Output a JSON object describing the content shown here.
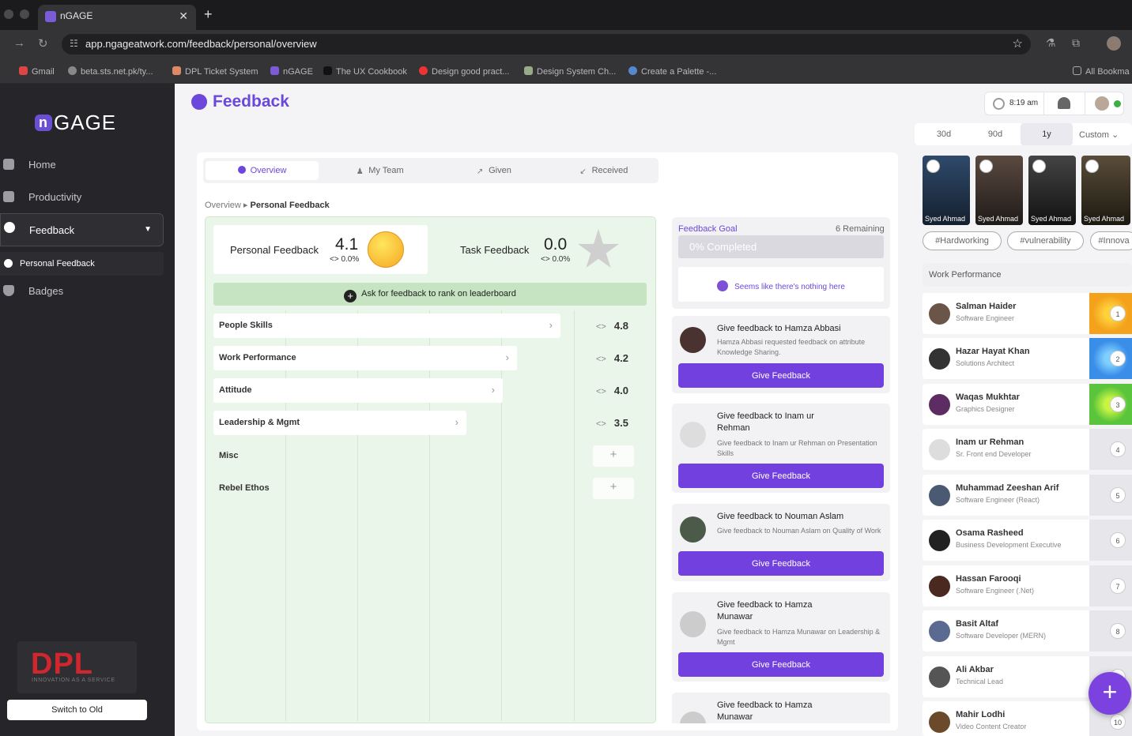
{
  "browser": {
    "tab_title": "nGAGE",
    "url": "app.ngageatwork.com/feedback/personal/overview",
    "bookmarks": [
      "Gmail",
      "beta.sts.net.pk/ty...",
      "DPL Ticket System",
      "nGAGE",
      "The UX Cookbook",
      "Design good pract...",
      "Design System Ch...",
      "Create a Palette -..."
    ],
    "all_bookmarks": "All Bookma"
  },
  "sidebar": {
    "logo": "GAGE",
    "logo_prefix": "n",
    "items": [
      {
        "label": "Home"
      },
      {
        "label": "Productivity"
      },
      {
        "label": "Feedback"
      },
      {
        "label": "Personal Feedback"
      },
      {
        "label": "Badges"
      }
    ],
    "dpl": {
      "title": "DPL",
      "tagline": "INNOVATION AS A SERVICE"
    },
    "switch_label": "Switch to Old"
  },
  "header": {
    "title": "Feedback",
    "time": "8:19 am"
  },
  "periods": [
    "30d",
    "90d",
    "1y",
    "Custom"
  ],
  "tabs": [
    "Overview",
    "My Team",
    "Given",
    "Received"
  ],
  "breadcrumb": {
    "parent": "Overview",
    "current": "Personal Feedback"
  },
  "scores": {
    "personal": {
      "label": "Personal Feedback",
      "value": "4.1",
      "change": "<> 0.0%"
    },
    "task": {
      "label": "Task Feedback",
      "value": "0.0",
      "change": "<> 0.0%"
    },
    "ask": "Ask for feedback to rank on leaderboard"
  },
  "attributes": [
    {
      "name": "People Skills",
      "score": "4.8"
    },
    {
      "name": "Work Performance",
      "score": "4.2"
    },
    {
      "name": "Attitude",
      "score": "4.0"
    },
    {
      "name": "Leadership & Mgmt",
      "score": "3.5"
    },
    {
      "name": "Misc",
      "score": ""
    },
    {
      "name": "Rebel Ethos",
      "score": ""
    }
  ],
  "goal": {
    "label": "Feedback Goal",
    "remaining": "6 Remaining",
    "progress": "0% Completed",
    "progress_value": 0,
    "empty": "Seems like there's nothing here"
  },
  "requests": [
    {
      "title": "Give feedback to Hamza Abbasi",
      "desc": "Hamza Abbasi requested feedback on attribute Knowledge Sharing.",
      "button": "Give Feedback"
    },
    {
      "title": "Give feedback to Inam ur Rehman",
      "desc": "Give feedback to Inam ur Rehman on Presentation Skills",
      "button": "Give Feedback"
    },
    {
      "title": "Give feedback to Nouman Aslam",
      "desc": "Give feedback to Nouman Aslam on Quality of Work",
      "button": "Give Feedback"
    },
    {
      "title": "Give feedback to Hamza Munawar",
      "desc": "Give feedback to Hamza Munawar on Leadership & Mgmt",
      "button": "Give Feedback"
    },
    {
      "title": "Give feedback to Hamza Munawar",
      "desc": "",
      "button": ""
    }
  ],
  "videos": [
    "Syed Ahmad",
    "Syed Ahmad",
    "Syed Ahmad",
    "Syed Ahmad"
  ],
  "tags": [
    "#Hardworking",
    "#vulnerability",
    "#Innova"
  ],
  "leaderboard": {
    "filter": "Work Performance",
    "rows": [
      {
        "name": "Salman Haider",
        "role": "Software Engineer",
        "rank": "1"
      },
      {
        "name": "Hazar Hayat Khan",
        "role": "Solutions Architect",
        "rank": "2"
      },
      {
        "name": "Waqas Mukhtar",
        "role": "Graphics Designer",
        "rank": "3"
      },
      {
        "name": "Inam ur Rehman",
        "role": "Sr. Front end Developer",
        "rank": "4"
      },
      {
        "name": "Muhammad Zeeshan Arif",
        "role": "Software Engineer (React)",
        "rank": "5"
      },
      {
        "name": "Osama Rasheed",
        "role": "Business Development Executive",
        "rank": "6"
      },
      {
        "name": "Hassan Farooqi",
        "role": "Software Engineer (.Net)",
        "rank": "7"
      },
      {
        "name": "Basit Altaf",
        "role": "Software Developer (MERN)",
        "rank": "8"
      },
      {
        "name": "Ali Akbar",
        "role": "Technical Lead",
        "rank": "9"
      },
      {
        "name": "Mahir Lodhi",
        "role": "Video Content Creator",
        "rank": "10"
      }
    ]
  },
  "colors": {
    "accent": "#6b47dc",
    "button": "#7340e0",
    "rank1": "#f4a21c",
    "rank2": "#3a8ee8",
    "rank3": "#5ac43c"
  }
}
